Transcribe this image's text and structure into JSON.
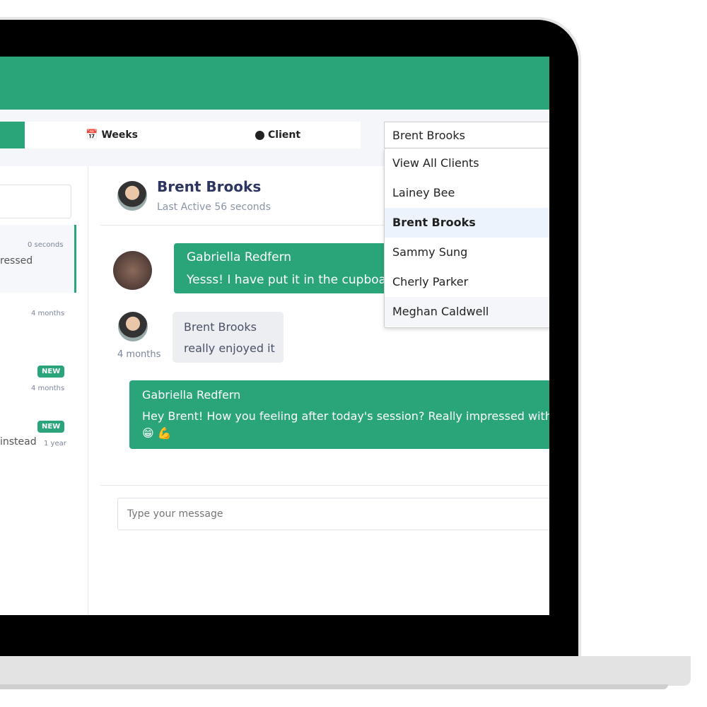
{
  "nav": {
    "weeks_label": "Weeks",
    "client_label": "Client",
    "weeks_icon": "calendar-icon",
    "client_icon": "user-circle-icon"
  },
  "sidebar": {
    "items": [
      {
        "time": "0 seconds",
        "preview": "ressed",
        "active": true
      },
      {
        "time": "4 months"
      },
      {
        "time": "4 months",
        "badge": "NEW"
      },
      {
        "time": "1 year",
        "badge": "NEW",
        "preview": "instead"
      }
    ]
  },
  "chat": {
    "contact_name": "Brent Brooks",
    "last_active": "Last Active 56 seconds",
    "messages": [
      {
        "sender": "Gabriella Redfern",
        "text": "Yesss! I have put it in the cupboar"
      },
      {
        "sender": "Brent Brooks",
        "text": "really enjoyed it",
        "time": "4 months"
      },
      {
        "sender": "Gabriella Redfern",
        "text": "Hey Brent! How you feeling after today's session? Really impressed with th",
        "emoji": "😁 💪"
      }
    ],
    "input_placeholder": "Type your message"
  },
  "client_select": {
    "selected": "Brent Brooks",
    "options": [
      "View All Clients",
      "Lainey Bee",
      "Brent Brooks",
      "Sammy Sung",
      "Cherly Parker",
      "Meghan Caldwell"
    ]
  },
  "colors": {
    "accent": "#2aa57a",
    "heading": "#2d3561"
  }
}
